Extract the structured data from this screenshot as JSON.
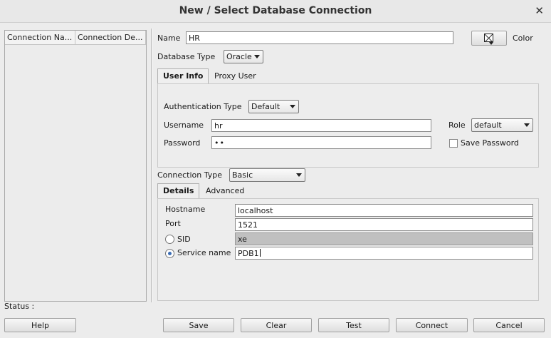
{
  "window": {
    "title": "New / Select Database Connection"
  },
  "connections": {
    "col1": "Connection Na...",
    "col2": "Connection De..."
  },
  "status": {
    "label": "Status :"
  },
  "form": {
    "name_label": "Name",
    "name_value": "HR",
    "color_label": "Color",
    "db_type_label": "Database Type",
    "db_type_value": "Oracle",
    "tabs": [
      "User Info",
      "Proxy User"
    ],
    "auth_type_label": "Authentication Type",
    "auth_type_value": "Default",
    "username_label": "Username",
    "username_value": "hr",
    "password_label": "Password",
    "password_value": "••",
    "role_label": "Role",
    "role_value": "default",
    "save_password_label": "Save Password",
    "connection_type_label": "Connection Type",
    "connection_type_value": "Basic",
    "detail_tabs": [
      "Details",
      "Advanced"
    ],
    "hostname_label": "Hostname",
    "hostname_value": "localhost",
    "port_label": "Port",
    "port_value": "1521",
    "sid_label": "SID",
    "sid_value": "xe",
    "service_name_label": "Service name",
    "service_name_value": "PDB1"
  },
  "buttons": {
    "help": "Help",
    "save": "Save",
    "clear": "Clear",
    "test": "Test",
    "connect": "Connect",
    "cancel": "Cancel"
  }
}
